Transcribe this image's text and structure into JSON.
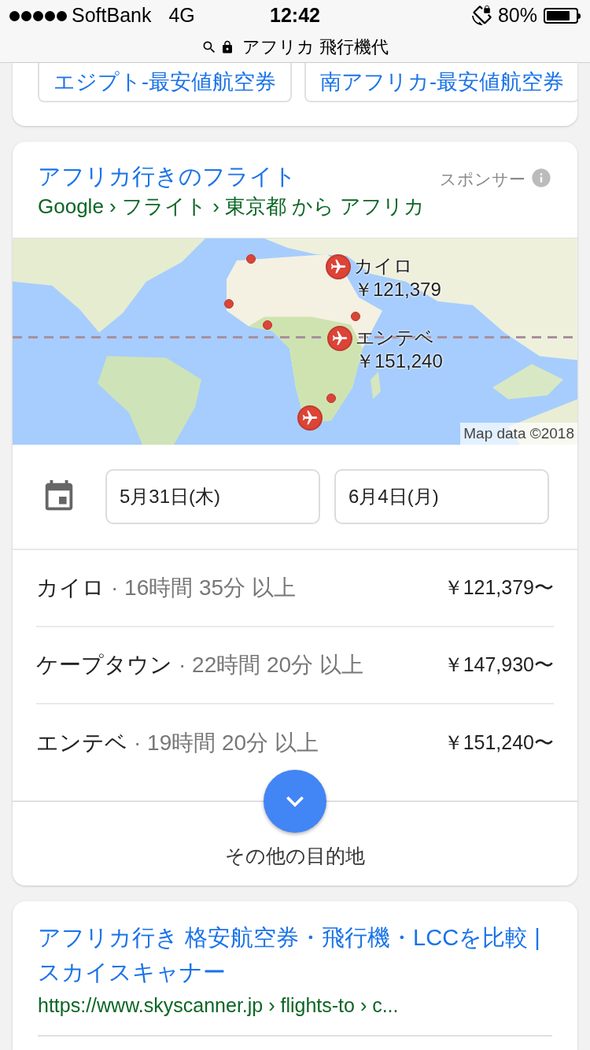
{
  "status_bar": {
    "carrier": "SoftBank",
    "network": "4G",
    "time": "12:42",
    "battery": "80%",
    "url": "アフリカ 飛行機代"
  },
  "related_chips": [
    "エジプト-最安値航空券",
    "南アフリカ-最安値航空券"
  ],
  "flight_card": {
    "title": "アフリカ行きのフライト",
    "sponsor": "スポンサー",
    "breadcrumb": "Google › フライト › 東京都 から アフリカ",
    "map": {
      "attribution": "Map data ©2018",
      "markers": [
        {
          "kind": "plane",
          "label": "カイロ",
          "price": "￥121,379"
        },
        {
          "kind": "plane",
          "label": "エンテベ",
          "price": "￥151,240"
        },
        {
          "kind": "plane"
        },
        {
          "kind": "dot"
        },
        {
          "kind": "dot"
        },
        {
          "kind": "dot"
        },
        {
          "kind": "dot"
        },
        {
          "kind": "dot"
        }
      ]
    },
    "dates": [
      "5月31日(木)",
      "6月4日(月)"
    ],
    "destinations": [
      {
        "city": "カイロ",
        "duration": "· 16時間 35分 以上",
        "price": "￥121,379〜"
      },
      {
        "city": "ケープタウン",
        "duration": "· 22時間 20分 以上",
        "price": "￥147,930〜"
      },
      {
        "city": "エンテベ",
        "duration": "· 19時間 20分 以上",
        "price": "￥151,240〜"
      }
    ],
    "more_label": "その他の目的地"
  },
  "result": {
    "title": "アフリカ行き 格安航空券・飛行機・LCCを比較 | スカイスキャナー",
    "url": "https://www.skyscanner.jp › flights-to › c..."
  }
}
